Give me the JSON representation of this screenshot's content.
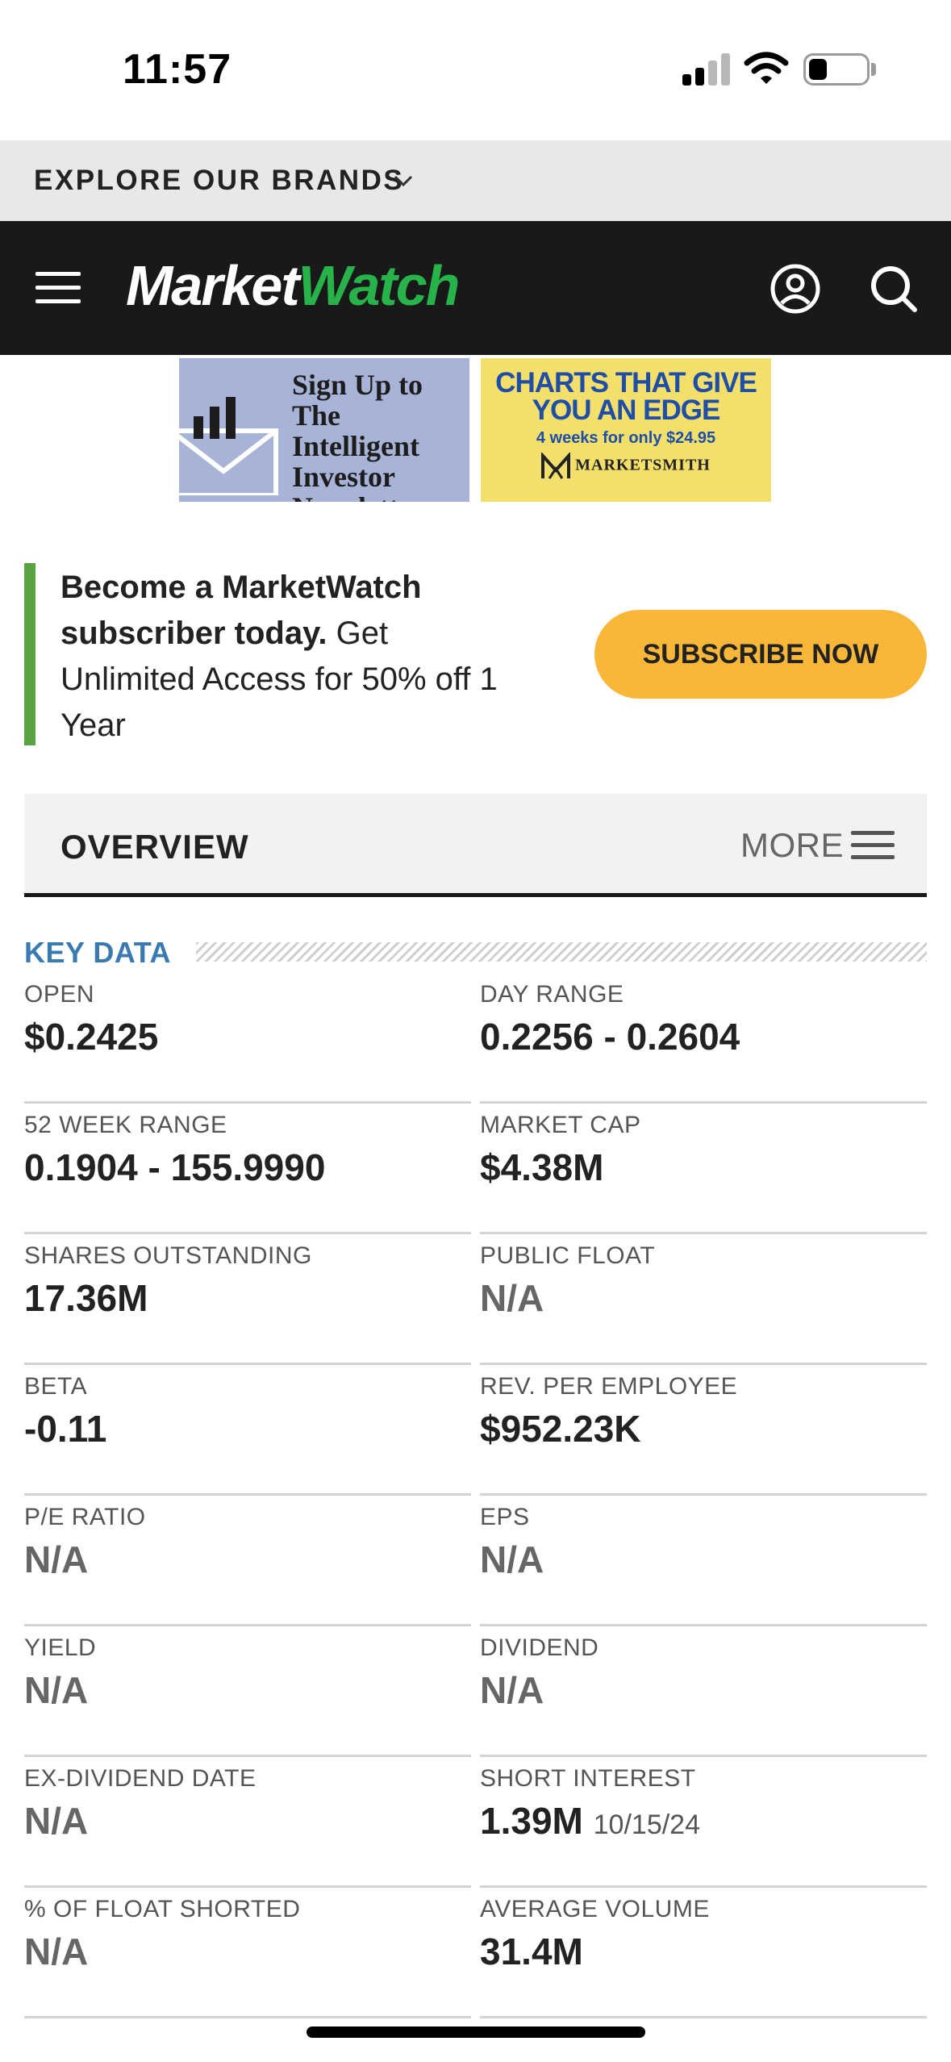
{
  "status_bar": {
    "time": "11:57"
  },
  "brands_bar": {
    "label": "EXPLORE OUR BRANDS"
  },
  "nav": {
    "logo_market": "Market",
    "logo_watch": "Watch"
  },
  "ads": {
    "left": {
      "line1": "Sign Up to",
      "line2": "The Intelligent",
      "line3": "Investor",
      "line4": "Newsletter"
    },
    "right": {
      "headline1": "CHARTS THAT GIVE",
      "headline2": "YOU AN EDGE",
      "offer": "4 weeks for only $24.95",
      "brand": "MARKETSMITH"
    }
  },
  "subscribe": {
    "bold_text": "Become a MarketWatch subscriber today.",
    "rest_text": " Get Unlimited Access for 50% off 1 Year",
    "button": "SUBSCRIBE NOW",
    "accent_color": "#5aa23f",
    "button_color": "#f9b739"
  },
  "overview": {
    "title": "OVERVIEW",
    "more": "MORE"
  },
  "key_data": {
    "title": "KEY DATA",
    "items": [
      {
        "label": "OPEN",
        "value": "$0.2425"
      },
      {
        "label": "DAY RANGE",
        "value": "0.2256 - 0.2604"
      },
      {
        "label": "52 WEEK RANGE",
        "value": "0.1904 - 155.9990"
      },
      {
        "label": "MARKET CAP",
        "value": "$4.38M"
      },
      {
        "label": "SHARES OUTSTANDING",
        "value": "17.36M"
      },
      {
        "label": "PUBLIC FLOAT",
        "value": "N/A"
      },
      {
        "label": "BETA",
        "value": "-0.11"
      },
      {
        "label": "REV. PER EMPLOYEE",
        "value": "$952.23K"
      },
      {
        "label": "P/E RATIO",
        "value": "N/A"
      },
      {
        "label": "EPS",
        "value": "N/A"
      },
      {
        "label": "YIELD",
        "value": "N/A"
      },
      {
        "label": "DIVIDEND",
        "value": "N/A"
      },
      {
        "label": "EX-DIVIDEND DATE",
        "value": "N/A"
      },
      {
        "label": "SHORT INTEREST",
        "value": "1.39M",
        "date": "10/15/24"
      },
      {
        "label": "% OF FLOAT SHORTED",
        "value": "N/A"
      },
      {
        "label": "AVERAGE VOLUME",
        "value": "31.4M"
      }
    ]
  }
}
